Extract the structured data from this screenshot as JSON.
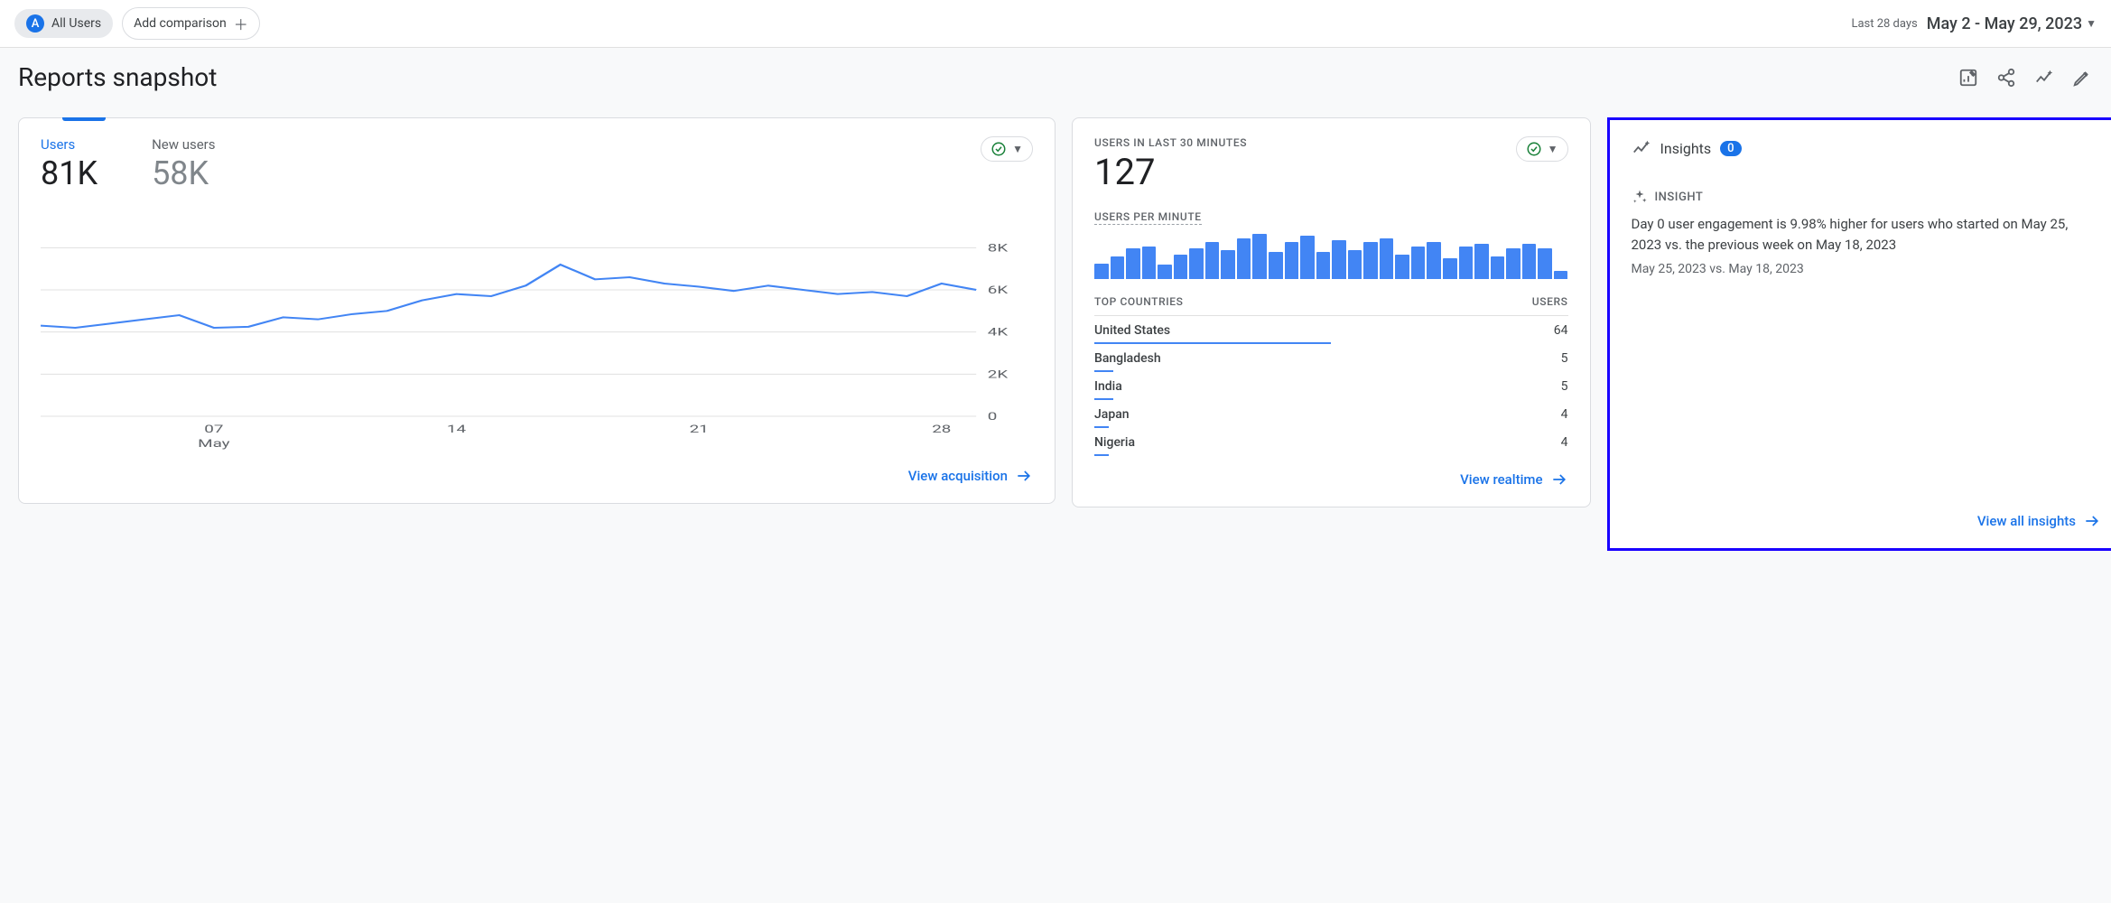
{
  "header": {
    "segment_badge": "A",
    "segment_label": "All Users",
    "add_comparison": "Add comparison",
    "range_label": "Last 28 days",
    "range_value": "May 2 - May 29, 2023"
  },
  "page_title": "Reports snapshot",
  "main_card": {
    "metrics": [
      {
        "label": "Users",
        "value": "81K",
        "active": true
      },
      {
        "label": "New users",
        "value": "58K",
        "active": false
      }
    ],
    "footer_link": "View acquisition"
  },
  "chart_data": {
    "type": "line",
    "xlabel": "",
    "ylabel": "",
    "ylim": [
      0,
      9000
    ],
    "y_ticks": [
      0,
      2000,
      4000,
      6000,
      8000
    ],
    "y_tick_labels": [
      "0",
      "2K",
      "4K",
      "6K",
      "8K"
    ],
    "x_tick_labels": [
      "07",
      "14",
      "21",
      "28"
    ],
    "x_sublabel": "May",
    "series": [
      {
        "name": "Users",
        "color": "#4285f4",
        "x_days": [
          2,
          3,
          4,
          5,
          6,
          7,
          8,
          9,
          10,
          11,
          12,
          13,
          14,
          15,
          16,
          17,
          18,
          19,
          20,
          21,
          22,
          23,
          24,
          25,
          26,
          27,
          28,
          29
        ],
        "values": [
          4300,
          4200,
          4400,
          4600,
          4800,
          4200,
          4250,
          4700,
          4600,
          4850,
          5000,
          5500,
          5800,
          5700,
          6200,
          7200,
          6500,
          6600,
          6300,
          6150,
          5950,
          6200,
          6000,
          5800,
          5900,
          5700,
          6300,
          6000
        ]
      }
    ]
  },
  "realtime_card": {
    "title": "USERS IN LAST 30 MINUTES",
    "value": "127",
    "per_minute_label": "USERS PER MINUTE",
    "bar_values": [
      15,
      22,
      30,
      32,
      14,
      24,
      30,
      36,
      28,
      40,
      44,
      26,
      36,
      42,
      26,
      38,
      28,
      36,
      40,
      24,
      32,
      36,
      20,
      32,
      34,
      22,
      30,
      34,
      30,
      8
    ],
    "countries_header_left": "TOP COUNTRIES",
    "countries_header_right": "USERS",
    "countries": [
      {
        "name": "United States",
        "users": 64,
        "pct": 50
      },
      {
        "name": "Bangladesh",
        "users": 5,
        "pct": 4
      },
      {
        "name": "India",
        "users": 5,
        "pct": 4
      },
      {
        "name": "Japan",
        "users": 4,
        "pct": 3
      },
      {
        "name": "Nigeria",
        "users": 4,
        "pct": 3
      }
    ],
    "footer_link": "View realtime"
  },
  "insights_card": {
    "title": "Insights",
    "count": "0",
    "tag": "INSIGHT",
    "text": "Day 0 user engagement is 9.98% higher for users who started on May 25, 2023 vs. the previous week on May 18, 2023",
    "date": "May 25, 2023 vs. May 18, 2023",
    "footer_link": "View all insights"
  }
}
